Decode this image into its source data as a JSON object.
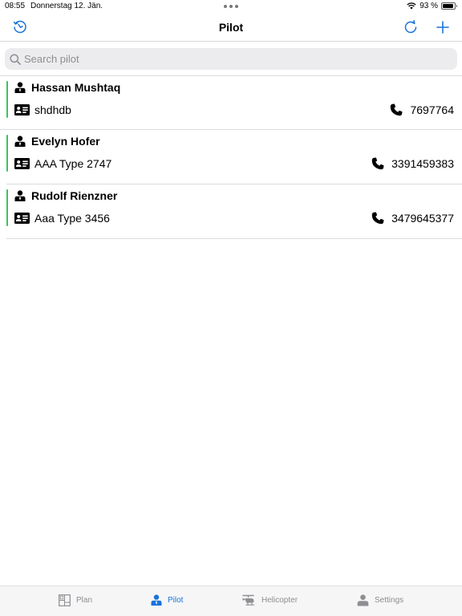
{
  "status_bar": {
    "time": "08:55",
    "date": "Donnerstag 12. Jän.",
    "battery": "93 %",
    "battery_level": 0.93
  },
  "nav": {
    "title": "Pilot",
    "left_icon": "history-icon",
    "right_icons": [
      "refresh-icon",
      "add-icon"
    ]
  },
  "search": {
    "placeholder": "Search pilot",
    "value": ""
  },
  "pilots": [
    {
      "name": "Hassan Mushtaq",
      "license": "shdhdb",
      "phone": "7697764"
    },
    {
      "name": "Evelyn Hofer",
      "license": "AAA Type 2747",
      "phone": "3391459383"
    },
    {
      "name": "Rudolf Rienzner",
      "license": "Aaa Type 3456",
      "phone": "3479645377"
    }
  ],
  "tabs": [
    {
      "label": "Plan",
      "icon": "plan-icon",
      "active": false
    },
    {
      "label": "Pilot",
      "icon": "pilot-icon",
      "active": true
    },
    {
      "label": "Helicopter",
      "icon": "helicopter-icon",
      "active": false
    },
    {
      "label": "Settings",
      "icon": "settings-icon",
      "active": false
    }
  ],
  "colors": {
    "accent": "#1a73d9",
    "active_indicator": "#34c759",
    "inactive_tab": "#8e8e93"
  }
}
